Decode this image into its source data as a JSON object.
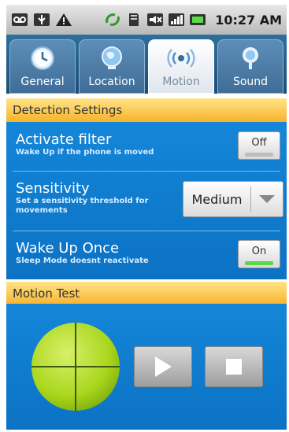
{
  "status_bar": {
    "time": "10:27 AM",
    "icons_left": [
      "voicemail-icon",
      "usb-icon",
      "warning-icon"
    ],
    "icons_right": [
      "sync-icon",
      "sd-card-icon",
      "mute-icon",
      "signal-icon",
      "battery-icon"
    ]
  },
  "tabs": [
    {
      "label": "General",
      "icon": "clock-icon",
      "active": false
    },
    {
      "label": "Location",
      "icon": "globe-icon",
      "active": false
    },
    {
      "label": "Motion",
      "icon": "motion-icon",
      "active": true
    },
    {
      "label": "Sound",
      "icon": "sound-icon",
      "active": false
    }
  ],
  "detection": {
    "header": "Detection Settings",
    "activate_filter": {
      "title": "Activate filter",
      "subtitle": "Wake Up if the phone is moved",
      "toggle_label": "Off"
    },
    "sensitivity": {
      "title": "Sensitivity",
      "subtitle_line1": "Set a sensitivity threshold for",
      "subtitle_line2": "movements",
      "selected": "Medium"
    },
    "wake_up_once": {
      "title": "Wake Up Once",
      "subtitle": "Sleep Mode doesnt reactivate",
      "toggle_label": "On"
    }
  },
  "motion_test": {
    "header": "Motion Test"
  },
  "colors": {
    "panel_blue": "#0c72c4",
    "header_orange": "#f7b22a",
    "ball_green": "#a8d61c",
    "toggle_on": "#5cd84a"
  }
}
